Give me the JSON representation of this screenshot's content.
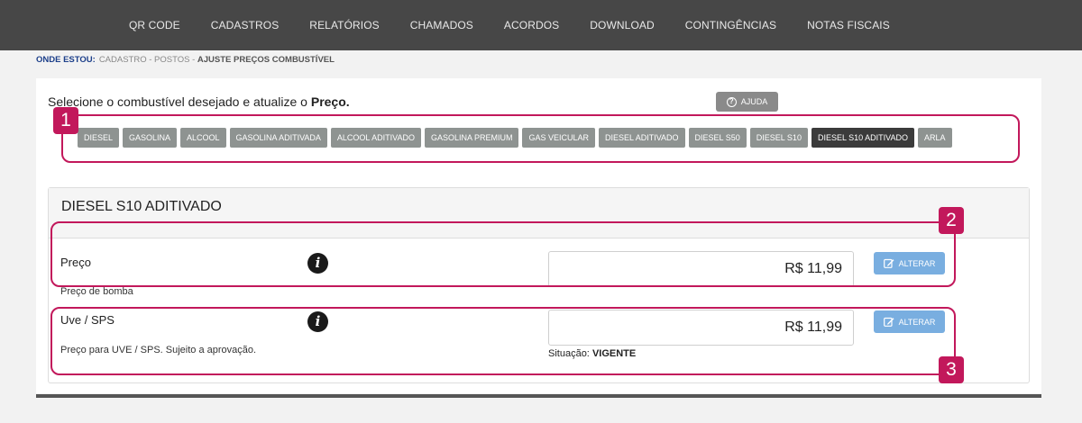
{
  "nav": {
    "items": [
      "QR CODE",
      "CADASTROS",
      "RELATÓRIOS",
      "CHAMADOS",
      "ACORDOS",
      "DOWNLOAD",
      "CONTINGÊNCIAS",
      "NOTAS FISCAIS"
    ]
  },
  "breadcrumb": {
    "label": "ONDE ESTOU:",
    "path": "CADASTRO - POSTOS - ",
    "current": "AJUSTE PREÇOS COMBUSTÍVEL"
  },
  "intro": {
    "text": "Selecione o combustível desejado e atualize o ",
    "bold": "Preço."
  },
  "help_button": {
    "label": "AJUDA",
    "icon": "question-circle-icon"
  },
  "fuels": {
    "items": [
      "DIESEL",
      "GASOLINA",
      "ALCOOL",
      "GASOLINA ADITIVADA",
      "ALCOOL ADITIVADO",
      "GASOLINA PREMIUM",
      "GAS VEICULAR",
      "DIESEL ADITIVADO",
      "DIESEL S50",
      "DIESEL S10",
      "DIESEL S10 ADITIVADO",
      "ARLA"
    ],
    "selected": "DIESEL S10 ADITIVADO"
  },
  "annotations": [
    "1",
    "2",
    "3"
  ],
  "panel": {
    "title": "DIESEL S10 ADITIVADO",
    "preco": {
      "label": "Preço",
      "description": "Preço de bomba",
      "value": "R$ 11,99",
      "button": "ALTERAR"
    },
    "uve": {
      "label": "Uve / SPS",
      "description": "Preço para UVE / SPS. Sujeito a aprovação.",
      "value": "R$ 11,99",
      "button": "ALTERAR",
      "status_label": "Situação:",
      "status_value": "VIGENTE"
    }
  },
  "colors": {
    "nav_bg": "#474747",
    "fuel_btn": "#8e9391",
    "fuel_btn_active": "#3b3b3b",
    "annotation": "#c2185b",
    "alter_btn": "#79aee0",
    "breadcrumb_label": "#1c3f8a"
  }
}
